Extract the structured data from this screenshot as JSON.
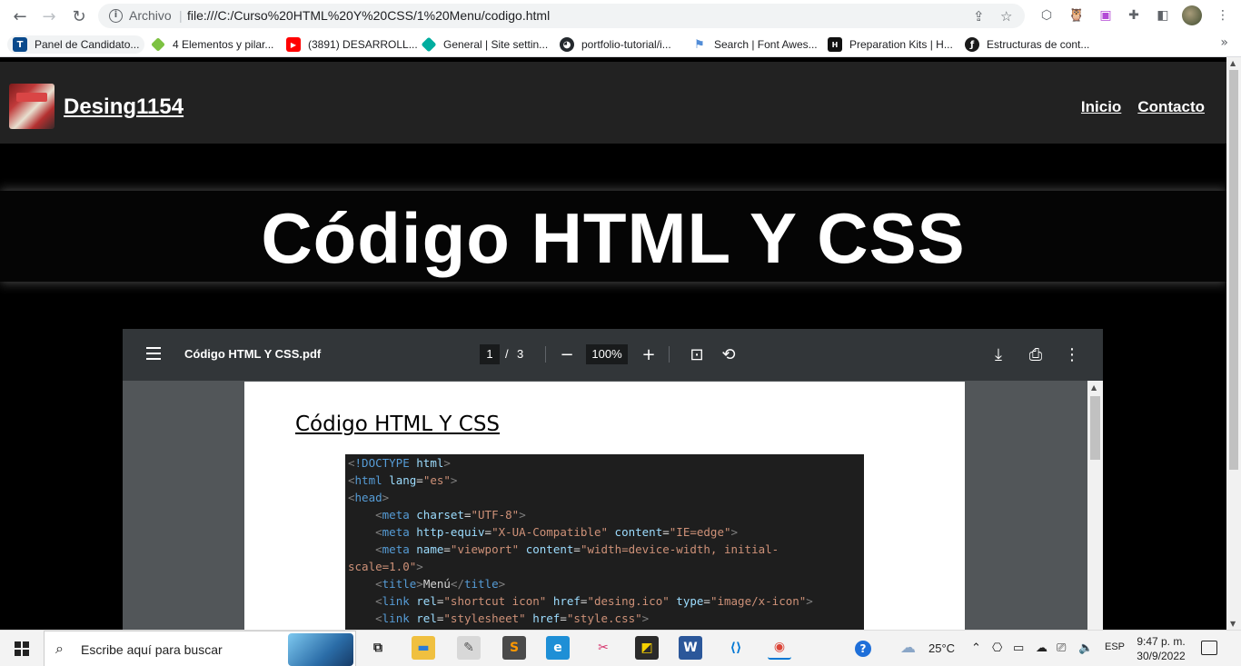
{
  "browser": {
    "scheme_label": "Archivo",
    "url": "file:///C:/Curso%20HTML%20Y%20CSS/1%20Menu/codigo.html",
    "bookmarks": [
      {
        "label": "Panel de Candidato...",
        "icon": "tt-icon",
        "color": "#0a4a8c"
      },
      {
        "label": "4 Elementos y pilar...",
        "icon": "diamond-icon",
        "color": "#7dc242"
      },
      {
        "label": "(3891) DESARROLL...",
        "icon": "youtube-icon",
        "color": "#ff0000"
      },
      {
        "label": "General | Site settin...",
        "icon": "netlify-icon",
        "color": "#00ad9f"
      },
      {
        "label": "portfolio-tutorial/i...",
        "icon": "github-icon",
        "color": "#24292e"
      },
      {
        "label": "Search | Font Awes...",
        "icon": "flag-icon",
        "color": "#528dd7"
      },
      {
        "label": "Preparation Kits | H...",
        "icon": "hackerrank-icon",
        "color": "#111111"
      },
      {
        "label": "Estructuras de cont...",
        "icon": "symfony-icon",
        "color": "#1a1a1a"
      }
    ]
  },
  "site": {
    "name": "Desing1154",
    "nav": [
      "Inicio",
      "Contacto"
    ],
    "hero_title": "Código HTML Y CSS"
  },
  "pdf": {
    "filename": "Código HTML Y CSS.pdf",
    "page_current": "1",
    "page_separator": "/",
    "page_total": "3",
    "zoom": "100%",
    "doc_title": "Código HTML Y CSS",
    "code_lines": [
      [
        [
          "punc",
          "<"
        ],
        [
          "tag",
          "!DOCTYPE"
        ],
        [
          "text",
          " "
        ],
        [
          "attr",
          "html"
        ],
        [
          "punc",
          ">"
        ]
      ],
      [
        [
          "punc",
          "<"
        ],
        [
          "tag",
          "html"
        ],
        [
          "text",
          " "
        ],
        [
          "attr",
          "lang"
        ],
        [
          "text",
          "="
        ],
        [
          "str",
          "\"es\""
        ],
        [
          "punc",
          ">"
        ]
      ],
      [
        [
          "punc",
          "<"
        ],
        [
          "tag",
          "head"
        ],
        [
          "punc",
          ">"
        ]
      ],
      [
        [
          "text",
          "    "
        ],
        [
          "punc",
          "<"
        ],
        [
          "tag",
          "meta"
        ],
        [
          "text",
          " "
        ],
        [
          "attr",
          "charset"
        ],
        [
          "text",
          "="
        ],
        [
          "str",
          "\"UTF-8\""
        ],
        [
          "punc",
          ">"
        ]
      ],
      [
        [
          "text",
          "    "
        ],
        [
          "punc",
          "<"
        ],
        [
          "tag",
          "meta"
        ],
        [
          "text",
          " "
        ],
        [
          "attr",
          "http-equiv"
        ],
        [
          "text",
          "="
        ],
        [
          "str",
          "\"X-UA-Compatible\""
        ],
        [
          "text",
          " "
        ],
        [
          "attr",
          "content"
        ],
        [
          "text",
          "="
        ],
        [
          "str",
          "\"IE=edge\""
        ],
        [
          "punc",
          ">"
        ]
      ],
      [
        [
          "text",
          "    "
        ],
        [
          "punc",
          "<"
        ],
        [
          "tag",
          "meta"
        ],
        [
          "text",
          " "
        ],
        [
          "attr",
          "name"
        ],
        [
          "text",
          "="
        ],
        [
          "str",
          "\"viewport\""
        ],
        [
          "text",
          " "
        ],
        [
          "attr",
          "content"
        ],
        [
          "text",
          "="
        ],
        [
          "str",
          "\"width=device-width, initial-"
        ]
      ],
      [
        [
          "str",
          "scale=1.0\""
        ],
        [
          "punc",
          ">"
        ]
      ],
      [
        [
          "text",
          "    "
        ],
        [
          "punc",
          "<"
        ],
        [
          "tag",
          "title"
        ],
        [
          "punc",
          ">"
        ],
        [
          "text",
          "Menú"
        ],
        [
          "punc",
          "</"
        ],
        [
          "tag",
          "title"
        ],
        [
          "punc",
          ">"
        ]
      ],
      [
        [
          "text",
          "    "
        ],
        [
          "punc",
          "<"
        ],
        [
          "tag",
          "link"
        ],
        [
          "text",
          " "
        ],
        [
          "attr",
          "rel"
        ],
        [
          "text",
          "="
        ],
        [
          "str",
          "\"shortcut icon\""
        ],
        [
          "text",
          " "
        ],
        [
          "attr",
          "href"
        ],
        [
          "text",
          "="
        ],
        [
          "str",
          "\"desing.ico\""
        ],
        [
          "text",
          " "
        ],
        [
          "attr",
          "type"
        ],
        [
          "text",
          "="
        ],
        [
          "str",
          "\"image/x-icon\""
        ],
        [
          "punc",
          ">"
        ]
      ],
      [
        [
          "text",
          "    "
        ],
        [
          "punc",
          "<"
        ],
        [
          "tag",
          "link"
        ],
        [
          "text",
          " "
        ],
        [
          "attr",
          "rel"
        ],
        [
          "text",
          "="
        ],
        [
          "str",
          "\"stylesheet\""
        ],
        [
          "text",
          " "
        ],
        [
          "attr",
          "href"
        ],
        [
          "text",
          "="
        ],
        [
          "str",
          "\"style.css\""
        ],
        [
          "punc",
          ">"
        ]
      ]
    ]
  },
  "taskbar": {
    "search_placeholder": "Escribe aquí para buscar",
    "weather": "25°C",
    "language": "ESP",
    "time": "9:47 p. m.",
    "date": "30/9/2022",
    "apps": [
      {
        "name": "task-view-icon",
        "glyph": "⧉",
        "color": "#f3f3f3",
        "fg": "#222"
      },
      {
        "name": "file-explorer-icon",
        "glyph": "▬",
        "color": "#f0c040",
        "fg": "#2b7bd6"
      },
      {
        "name": "tools-icon",
        "glyph": "✎",
        "color": "#d8d8d8",
        "fg": "#555"
      },
      {
        "name": "sublime-text-icon",
        "glyph": "S",
        "color": "#4a4a4a",
        "fg": "#ff9800"
      },
      {
        "name": "edge-icon",
        "glyph": "e",
        "color": "#1e8fd6",
        "fg": "#fff"
      },
      {
        "name": "snip-icon",
        "glyph": "✂",
        "color": "#f3f3f3",
        "fg": "#d6336c"
      },
      {
        "name": "sticky-notes-icon",
        "glyph": "◩",
        "color": "#2a2a2a",
        "fg": "#f5d000"
      },
      {
        "name": "word-icon",
        "glyph": "W",
        "color": "#2b579a",
        "fg": "#fff"
      },
      {
        "name": "vscode-icon",
        "glyph": "⟨⟩",
        "color": "#f3f3f3",
        "fg": "#0078d4"
      },
      {
        "name": "chrome-icon",
        "glyph": "◉",
        "color": "#f3f3f3",
        "fg": "#db4437"
      }
    ]
  }
}
